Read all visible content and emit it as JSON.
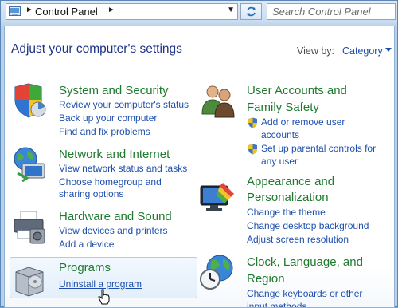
{
  "address_bar": {
    "breadcrumb": "Control Panel",
    "separator": "►",
    "dropdown_glyph": "▼",
    "refresh_icon": "refresh-icon"
  },
  "search": {
    "placeholder": "Search Control Panel"
  },
  "content": {
    "title": "Adjust your computer's settings",
    "view_by_label": "View by:",
    "view_by_value": "Category"
  },
  "categories": {
    "system_security": {
      "title": "System and Security",
      "icon": "shield-icon",
      "links": [
        "Review your computer's status",
        "Back up your computer",
        "Find and fix problems"
      ]
    },
    "network": {
      "title": "Network and Internet",
      "icon": "network-globe-icon",
      "links": [
        "View network status and tasks",
        "Choose homegroup and",
        "sharing options"
      ]
    },
    "hardware": {
      "title": "Hardware and Sound",
      "icon": "printer-icon",
      "links": [
        "View devices and printers",
        "Add a device"
      ]
    },
    "programs": {
      "title": "Programs",
      "icon": "programs-box-icon",
      "links": [
        "Uninstall a program"
      ]
    },
    "user_accounts": {
      "title_line1": "User Accounts and",
      "title_line2": "Family Safety",
      "icon": "users-icon",
      "links": [
        "Add or remove user",
        "accounts",
        "Set up parental controls for",
        "any user"
      ]
    },
    "appearance": {
      "title_line1": "Appearance and",
      "title_line2": "Personalization",
      "icon": "monitor-paint-icon",
      "links": [
        "Change the theme",
        "Change desktop background",
        "Adjust screen resolution"
      ]
    },
    "clock": {
      "title_line1": "Clock, Language, and",
      "title_line2": "Region",
      "icon": "globe-clock-icon",
      "links": [
        "Change keyboards or other",
        "input methods"
      ]
    }
  },
  "colors": {
    "category_title": "#1e7a2e",
    "link": "#1e4fae",
    "heading": "#1e3287"
  }
}
